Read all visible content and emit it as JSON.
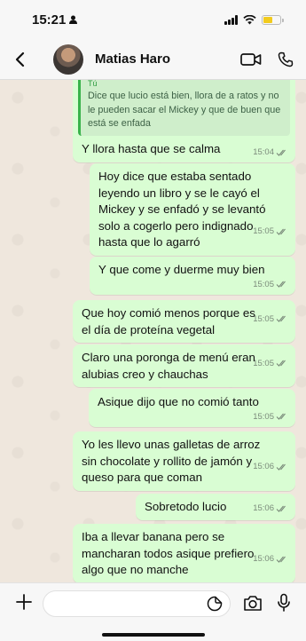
{
  "status_bar": {
    "time": "15:21"
  },
  "header": {
    "contact_name": "Matias Haro"
  },
  "quote": {
    "author": "Tú",
    "text": "Dice que lucio está bien, llora de a ratos y no le pueden sacar el Mickey y que de buen que está se enfada"
  },
  "messages": [
    {
      "text": "Y llora hasta que se calma",
      "time": "15:04"
    },
    {
      "text": "Hoy dice que estaba sentado\nleyendo un libro y se le cayó el\nMickey y se enfadó y se levantó\nsolo a cogerlo pero indignado\nhasta que lo agarró",
      "time": "15:05"
    },
    {
      "text": "Y que come y duerme muy bien",
      "time": "15:05"
    },
    {
      "text": "Que hoy comió menos porque es\nel día de proteína vegetal",
      "time": "15:05"
    },
    {
      "text": "Claro una poronga de menú eran\nalubias creo y chauchas",
      "time": "15:05"
    },
    {
      "text": "Asique dijo que no comió tanto",
      "time": "15:05"
    },
    {
      "text": "Yo les llevo unas galletas de arroz\nsin chocolate y rollito de jamón y\nqueso para que coman",
      "time": "15:06"
    },
    {
      "text": "Sobretodo lucio",
      "time": "15:06"
    },
    {
      "text": "Iba a llevar banana pero se\nmancharan todos asique prefiero\nalgo que no manche",
      "time": "15:06"
    }
  ],
  "input": {
    "value": "",
    "placeholder": ""
  },
  "colors": {
    "outgoing_bubble": "#d9fdd3",
    "chat_bg": "#efe7dd",
    "read_ticks": "#7a8a7a"
  }
}
